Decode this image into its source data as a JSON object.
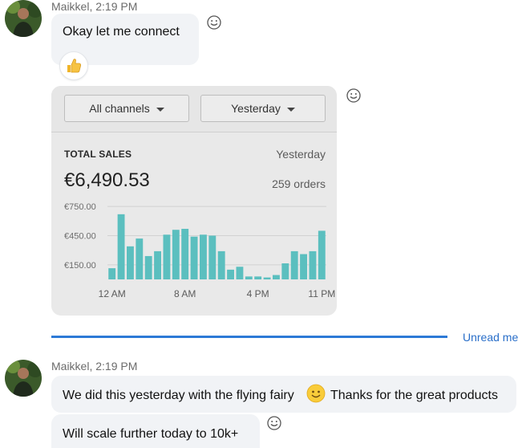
{
  "messages": [
    {
      "sender": "Maikkel, 2:19 PM",
      "text": "Okay let me connect",
      "reaction": "thumbs-up"
    },
    {
      "sender": "Maikkel, 2:19 PM",
      "line1_a": "We did this yesterday with the flying fairy",
      "line1_b": "Thanks for the great products",
      "line2": "Will scale further today to 10k+"
    }
  ],
  "sales_card": {
    "channel_filter": "All channels",
    "period_filter": "Yesterday",
    "label": "TOTAL SALES",
    "period": "Yesterday",
    "total": "€6,490.53",
    "orders": "259 orders"
  },
  "chart_data": {
    "type": "bar",
    "yticks": [
      "€750.00",
      "€450.00",
      "€150.00"
    ],
    "ytick_values": [
      750,
      450,
      150
    ],
    "xticks": [
      "12 AM",
      "8 AM",
      "4 PM",
      "11 PM"
    ],
    "xtick_hours": [
      0,
      8,
      16,
      23
    ],
    "ylim": [
      0,
      900
    ],
    "bar_color": "#5bbfbf",
    "hours": [
      0,
      1,
      2,
      3,
      4,
      5,
      6,
      7,
      8,
      9,
      10,
      11,
      12,
      13,
      14,
      15,
      16,
      17,
      18,
      19,
      20,
      21,
      22,
      23
    ],
    "values": [
      115,
      670,
      340,
      420,
      240,
      290,
      460,
      510,
      520,
      440,
      460,
      450,
      290,
      100,
      130,
      30,
      30,
      20,
      45,
      165,
      290,
      260,
      290,
      500
    ]
  },
  "unread_label": "Unread me",
  "colors": {
    "accent": "#2d7ad6",
    "bubble": "#f1f3f6",
    "card": "#e9e9e9"
  }
}
